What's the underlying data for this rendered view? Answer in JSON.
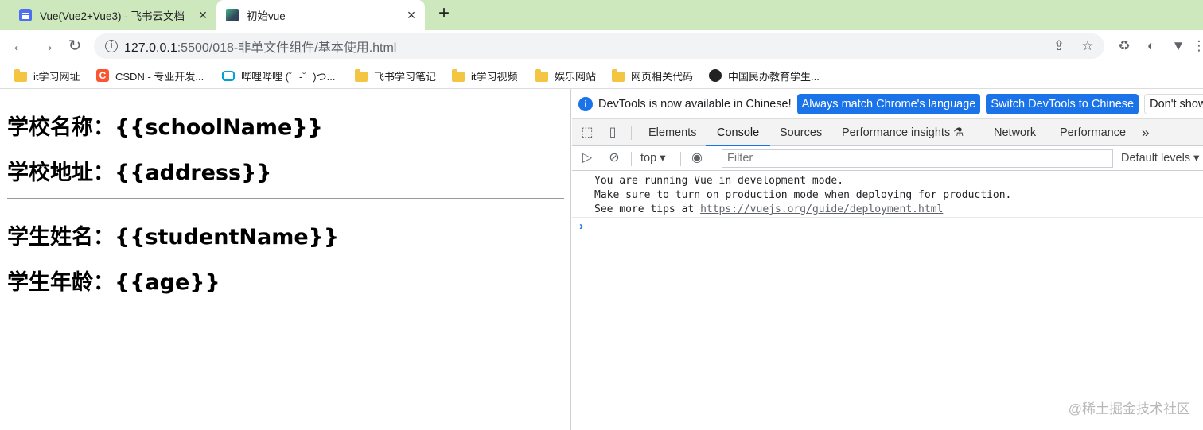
{
  "tabs": [
    {
      "title": "Vue(Vue2+Vue3) - 飞书云文档",
      "active": false
    },
    {
      "title": "初始vue",
      "active": true
    }
  ],
  "toolbar": {
    "url_host": "127.0.0.1",
    "url_path": ":5500/018-非单文件组件/基本使用.html"
  },
  "bookmarks": [
    {
      "label": "it学习网址",
      "icon": "folder-icon"
    },
    {
      "label": "CSDN - 专业开发...",
      "icon": "csdn-icon"
    },
    {
      "label": "哔哩哔哩 (゜-゜)つ...",
      "icon": "bilibili-icon"
    },
    {
      "label": "飞书学习笔记",
      "icon": "folder-icon"
    },
    {
      "label": "it学习视频",
      "icon": "folder-icon"
    },
    {
      "label": "娱乐网站",
      "icon": "folder-icon"
    },
    {
      "label": "网页相关代码",
      "icon": "folder-icon"
    },
    {
      "label": "中国民办教育学生...",
      "icon": "globe-icon"
    }
  ],
  "page": {
    "school_name_line": "学校名称：{{schoolName}}",
    "school_address_line": "学校地址：{{address}}",
    "student_name_line": "学生姓名：{{studentName}}",
    "student_age_line": "学生年龄：{{age}}"
  },
  "devtools": {
    "info_text": "DevTools is now available in Chinese!",
    "btn_match": "Always match Chrome's language",
    "btn_switch": "Switch DevTools to Chinese",
    "btn_dont_show": "Don't show again",
    "tabs": {
      "elements": "Elements",
      "console": "Console",
      "sources": "Sources",
      "perf_insights": "Performance insights",
      "network": "Network",
      "performance": "Performance"
    },
    "console_bar": {
      "context": "top",
      "filter_placeholder": "Filter",
      "levels": "Default levels"
    },
    "messages": {
      "line1": "You are running Vue in development mode.",
      "line2": "Make sure to turn on production mode when deploying for production.",
      "line3_prefix": "See more tips at ",
      "line3_link": "https://vuejs.org/guide/deployment.html"
    }
  },
  "watermark": "@稀土掘金技术社区",
  "colors": {
    "tabstrip_bg": "#cde8bd",
    "devtools_accent": "#1a73e8"
  }
}
